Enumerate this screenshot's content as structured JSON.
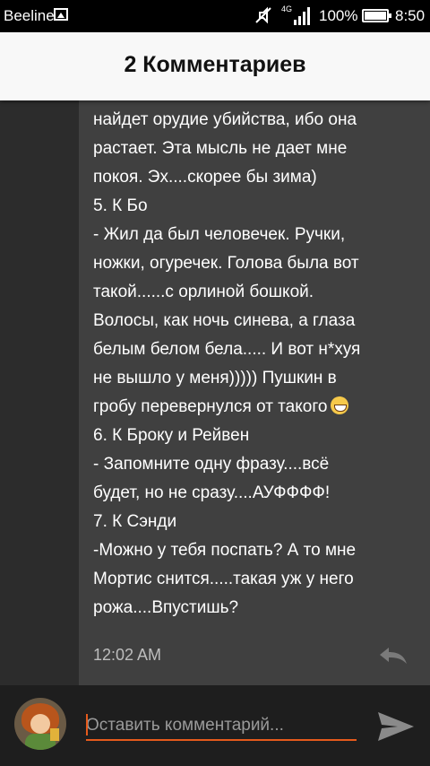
{
  "status_bar": {
    "carrier": "Beeline",
    "network": "4G",
    "battery": "100%",
    "time": "8:50"
  },
  "header": {
    "title": "2 Комментариев"
  },
  "comment": {
    "text_before_emoji": "Человека осеулькой, то никто же не\nнайдет орудие убийства, ибо она\nрастает. Эта мысль не дает мне\nпокоя. Эх....скорее бы зима)\n5. К Бо\n- Жил да был человечек. Ручки,\nножки, огуречек. Голова была вот\nтакой......с орлиной бошкой.\nВолосы, как ночь синева, а глаза\nбелым белом бела..... И вот н*хуя\nне вышло у меня))))) Пушкин в\nгробу перевернулся от такого",
    "text_after_emoji": "\n6. К Броку и Рейвен\n- Запомните одну фразу....всё\nбудет, но не сразу....АУФФФФ!\n7. К Сэнди\n-Можно у тебя поспать? А то мне\nМортис снится.....такая уж у него\nрожа....Впустишь?",
    "emoji": "grinning-face",
    "timestamp": "12:02 AM"
  },
  "input": {
    "placeholder": "Оставить комментарий..."
  },
  "colors": {
    "accent": "#e55a1c",
    "background": "#2c2c2c",
    "card": "#404040",
    "header_bg": "#f8f8f8"
  },
  "icons": [
    "image-icon",
    "mute-icon",
    "signal-icon",
    "battery-icon",
    "grin-emoji",
    "reply-icon",
    "send-icon",
    "avatar"
  ]
}
